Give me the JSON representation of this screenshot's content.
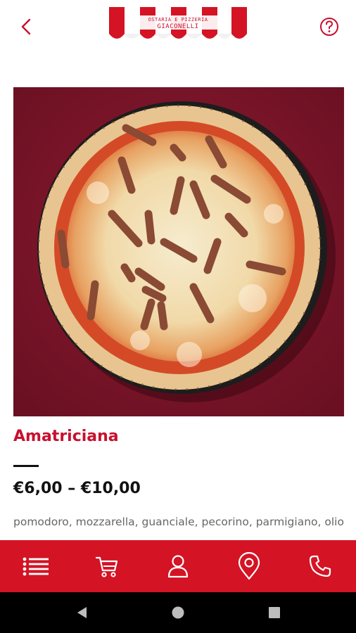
{
  "header": {
    "logo_line1": "OSTARIA E PIZZERIA",
    "logo_line2": "GIACONELLI",
    "back_icon": "chevron-left-icon",
    "help_icon": "help-circle-icon"
  },
  "product": {
    "name": "Amatriciana",
    "price": "€6,00 – €10,00",
    "ingredients": "pomodoro, mozzarella, guanciale, pecorino, parmigiano, olio"
  },
  "bottom_nav": {
    "items": [
      {
        "icon": "menu-list-icon"
      },
      {
        "icon": "cart-icon"
      },
      {
        "icon": "user-icon"
      },
      {
        "icon": "location-pin-icon"
      },
      {
        "icon": "phone-icon"
      }
    ]
  },
  "colors": {
    "brand_red": "#d41324",
    "title_red": "#c8102e",
    "photo_bg": "#7d1529"
  }
}
